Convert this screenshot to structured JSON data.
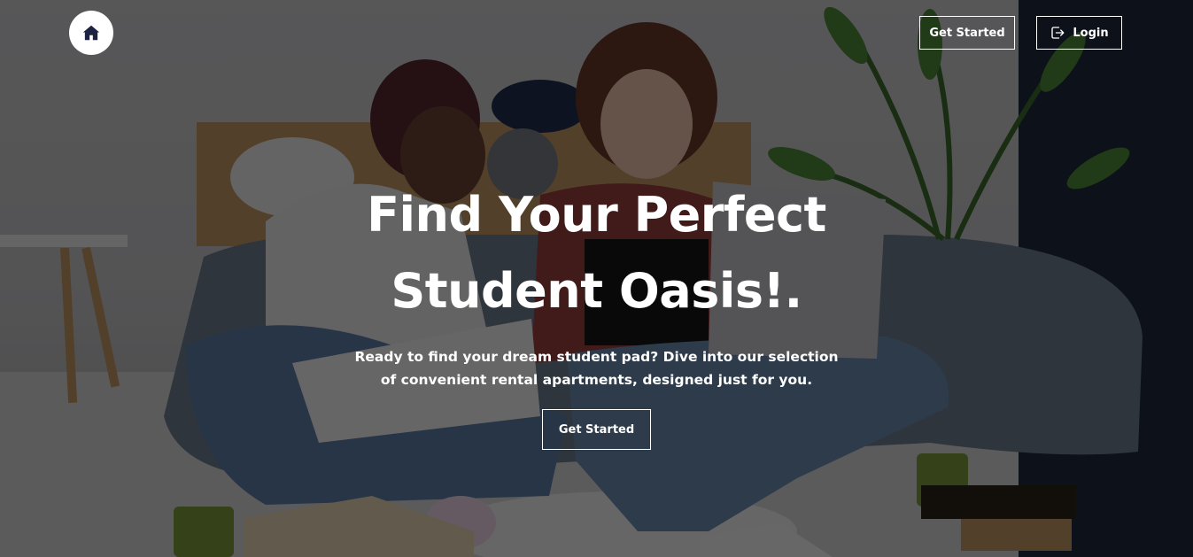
{
  "header": {
    "home_icon": "home-icon",
    "get_started_label": "Get Started",
    "login_label": "Login",
    "login_icon": "sign-in-icon"
  },
  "hero": {
    "title": "Find Your Perfect Student Oasis!.",
    "subtitle": "Ready to find your dream student pad? Dive into our selection of convenient rental apartments, designed just for you.",
    "cta_label": "Get Started"
  },
  "colors": {
    "overlay": "#000000",
    "text": "#ffffff",
    "home_button_bg": "#ffffff",
    "home_icon": "#1b2340"
  }
}
